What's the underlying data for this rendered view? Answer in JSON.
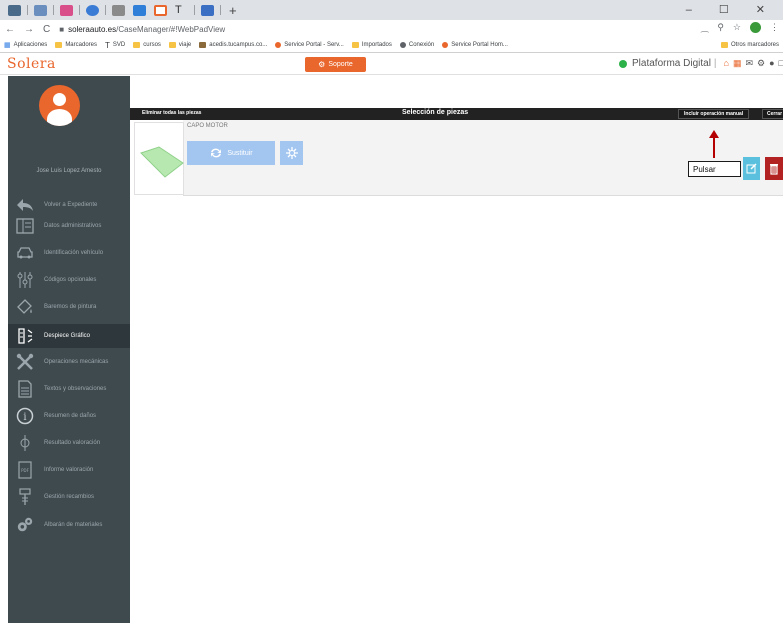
{
  "browser": {
    "window_controls": "–   ☐   ✕",
    "new_tab": "+",
    "url_host": "soleraauto.es",
    "url_path": "/CaseManager/#!WebPadView",
    "bookmarks": [
      {
        "label": "Aplicaciones",
        "kind": "grid"
      },
      {
        "label": "Marcadores",
        "kind": "folder"
      },
      {
        "label": "SVD",
        "kind": "svd"
      },
      {
        "label": "cursos",
        "kind": "folder"
      },
      {
        "label": "viaje",
        "kind": "folder"
      },
      {
        "label": "acedis.tucampus.co...",
        "kind": "folder"
      },
      {
        "label": "Service Portal - Serv...",
        "kind": "circle"
      },
      {
        "label": "Importados",
        "kind": "folder"
      },
      {
        "label": "Conexión",
        "kind": "globe"
      },
      {
        "label": "Service Portal Hom...",
        "kind": "circle"
      }
    ],
    "other_bookmarks": "Otros marcadores"
  },
  "header": {
    "logo": "Solera",
    "support_label": "Soporte",
    "platform_label": "Plataforma Digital"
  },
  "sidebar": {
    "user_name": "Jose Luis Lopez Amesto",
    "items": [
      {
        "label": "Volver a Expediente",
        "icon": "back-arrow-icon",
        "active": false
      },
      {
        "label": "Datos administrativos",
        "icon": "admin-data-icon",
        "active": false
      },
      {
        "label": "Identificación vehículo",
        "icon": "car-icon",
        "active": false
      },
      {
        "label": "Códigos opcionales",
        "icon": "sliders-icon",
        "active": false
      },
      {
        "label": "Baremos de pintura",
        "icon": "paint-bucket-icon",
        "active": false
      },
      {
        "label": "Despiece Gráfico",
        "icon": "parts-diagram-icon",
        "active": true
      },
      {
        "label": "Operaciones mecánicas",
        "icon": "wrench-icon",
        "active": false
      },
      {
        "label": "Textos y observaciones",
        "icon": "document-icon",
        "active": false
      },
      {
        "label": "Resumen de daños",
        "icon": "info-icon",
        "active": false
      },
      {
        "label": "Resultado valoración",
        "icon": "valuation-icon",
        "active": false
      },
      {
        "label": "Informe valoración",
        "icon": "report-icon",
        "active": false
      },
      {
        "label": "Gestión recambios",
        "icon": "spare-parts-icon",
        "active": false
      },
      {
        "label": "Albarán de materiales",
        "icon": "gears-icon",
        "active": false
      }
    ]
  },
  "toolbar": {
    "remove_all_label": "Eliminar todas las piezas",
    "title": "Selección de piezas",
    "manual_op_label": "Incluir operación manual",
    "close_label": "Cerrar"
  },
  "piece": {
    "name": "CAPO MOTOR",
    "replace_label": "Sustituir"
  },
  "callout": {
    "label": "Pulsar"
  },
  "colors": {
    "brand_orange": "#e9662c",
    "sidebar_bg": "#3f4a4f",
    "toolbar_bg": "#222222",
    "action_blue": "#a3c6f0",
    "delete_red": "#b22222",
    "arrow_red": "#b40000"
  }
}
